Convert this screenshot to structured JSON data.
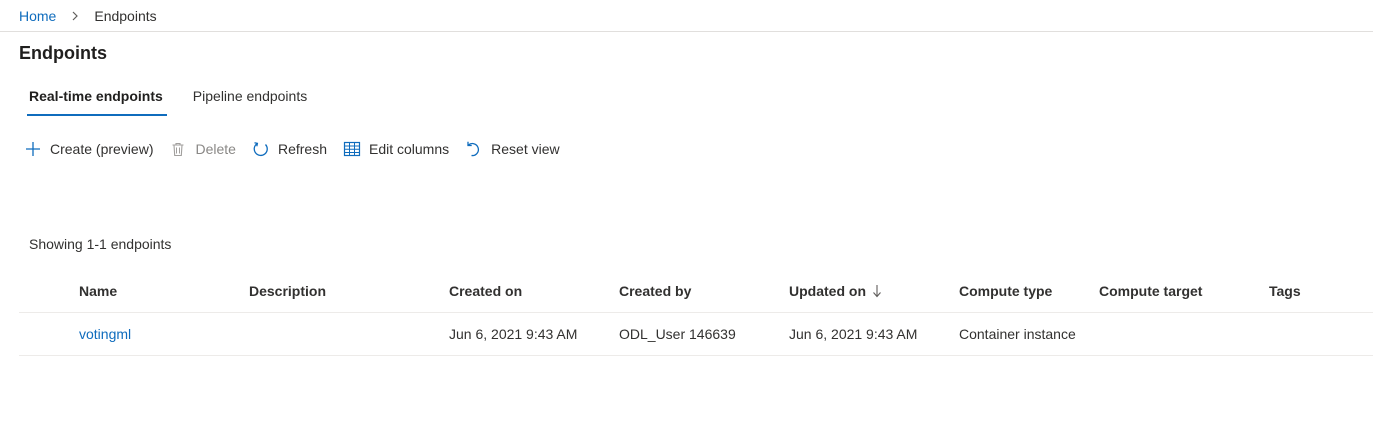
{
  "breadcrumb": {
    "home": "Home",
    "current": "Endpoints"
  },
  "page": {
    "title": "Endpoints"
  },
  "tabs": [
    {
      "label": "Real-time endpoints",
      "active": true
    },
    {
      "label": "Pipeline endpoints",
      "active": false
    }
  ],
  "toolbar": {
    "create": "Create (preview)",
    "delete": "Delete",
    "refresh": "Refresh",
    "edit_columns": "Edit columns",
    "reset_view": "Reset view"
  },
  "showing": "Showing 1-1 endpoints",
  "table": {
    "columns": [
      "Name",
      "Description",
      "Created on",
      "Created by",
      "Updated on",
      "Compute type",
      "Compute target",
      "Tags"
    ],
    "rows": [
      {
        "name": "votingml",
        "description": "",
        "created_on": "Jun 6, 2021 9:43 AM",
        "created_by": "ODL_User 146639",
        "updated_on": "Jun 6, 2021 9:43 AM",
        "compute_type": "Container instance",
        "compute_target": "",
        "tags": ""
      }
    ]
  },
  "colors": {
    "accent": "#0f6cbd",
    "text": "#323130",
    "divider": "#edebe9"
  }
}
